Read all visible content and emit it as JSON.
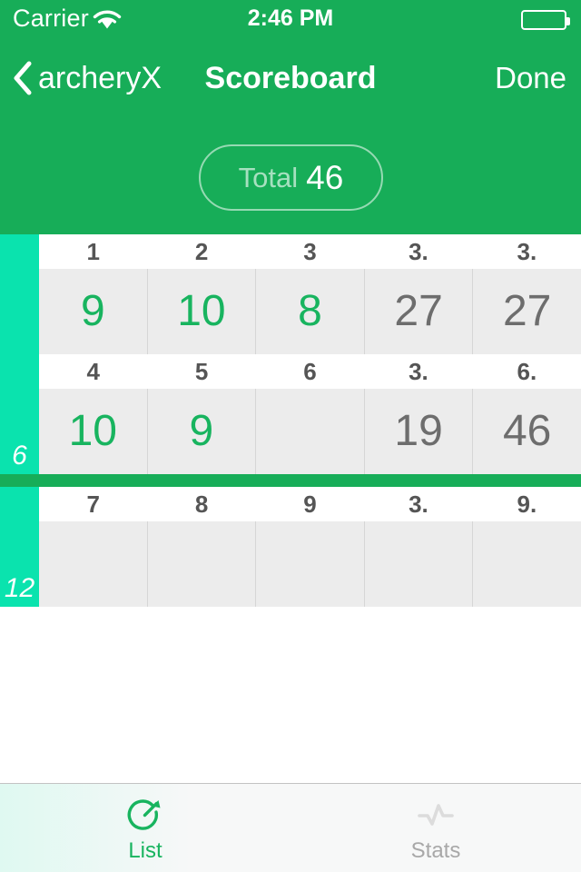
{
  "status_bar": {
    "carrier": "Carrier",
    "wifi_icon": "wifi-icon",
    "time": "2:46 PM",
    "battery_icon": "battery-icon"
  },
  "nav_bar": {
    "back_icon": "chevron-left-icon",
    "back_label": "archeryX",
    "title": "Scoreboard",
    "done_label": "Done"
  },
  "total": {
    "label": "Total",
    "value": "46"
  },
  "colors": {
    "nav_green": "#17ad58",
    "rail_cyan": "#0ae3ae",
    "score_green": "#18b45f",
    "sum_gray": "#6d6d6d",
    "header_gray": "#555555",
    "cell_bg": "#ececec"
  },
  "scoreboard": {
    "ends": [
      {
        "end_number": "6",
        "rows": [
          {
            "headers": [
              "1",
              "2",
              "3",
              "3.",
              "3."
            ],
            "values": [
              "9",
              "10",
              "8",
              "27",
              "27"
            ],
            "types": [
              "score",
              "score",
              "score",
              "sum",
              "sum"
            ]
          },
          {
            "headers": [
              "4",
              "5",
              "6",
              "3.",
              "6."
            ],
            "values": [
              "10",
              "9",
              "",
              "19",
              "46"
            ],
            "types": [
              "score",
              "score",
              "score",
              "sum",
              "sum"
            ]
          }
        ]
      },
      {
        "end_number": "12",
        "rows": [
          {
            "headers": [
              "7",
              "8",
              "9",
              "3.",
              "9."
            ],
            "values": [
              "",
              "",
              "",
              "",
              ""
            ],
            "types": [
              "score",
              "score",
              "score",
              "sum",
              "sum"
            ]
          }
        ]
      }
    ]
  },
  "tab_bar": {
    "tabs": [
      {
        "label": "List",
        "icon": "target-arrow-icon",
        "active": true
      },
      {
        "label": "Stats",
        "icon": "pulse-line-icon",
        "active": false
      }
    ]
  }
}
